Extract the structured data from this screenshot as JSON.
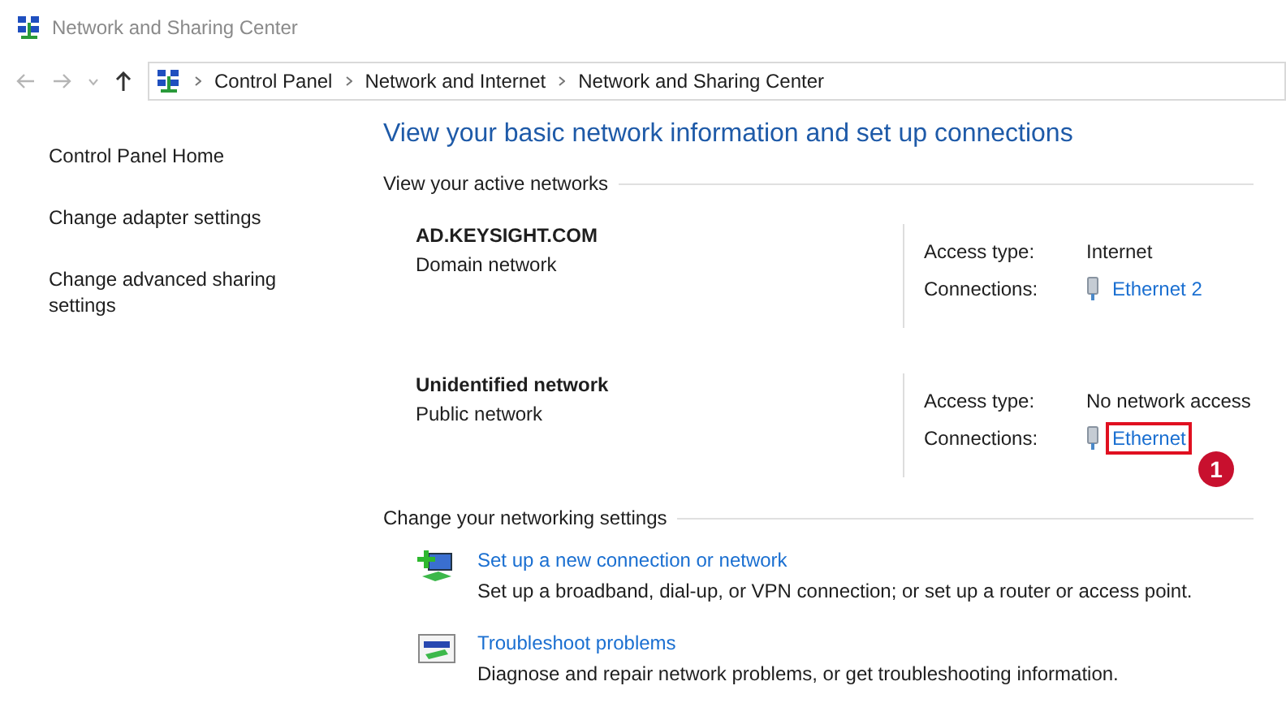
{
  "window": {
    "title": "Network and Sharing Center"
  },
  "address_bar": {
    "crumbs": [
      "Control Panel",
      "Network and Internet",
      "Network and Sharing Center"
    ]
  },
  "sidebar": {
    "items": [
      {
        "label": "Control Panel Home"
      },
      {
        "label": "Change adapter settings"
      },
      {
        "label": "Change advanced sharing settings"
      }
    ]
  },
  "heading": "View your basic network information and set up connections",
  "active_networks": {
    "title": "View your active networks",
    "networks": [
      {
        "name": "AD.KEYSIGHT.COM",
        "category": "Domain network",
        "access_label": "Access type:",
        "access": "Internet",
        "connections_label": "Connections:",
        "connection": "Ethernet 2",
        "highlighted": false
      },
      {
        "name": "Unidentified network",
        "category": "Public network",
        "access_label": "Access type:",
        "access": "No network access",
        "connections_label": "Connections:",
        "connection": "Ethernet",
        "highlighted": true,
        "callout": "1"
      }
    ]
  },
  "settings": {
    "title": "Change your networking settings",
    "items": [
      {
        "kind": "new-connection",
        "link": "Set up a new connection or network",
        "description": "Set up a broadband, dial-up, or VPN connection; or set up a router or access point."
      },
      {
        "kind": "troubleshoot",
        "link": "Troubleshoot problems",
        "description": "Diagnose and repair network problems, or get troubleshooting information."
      }
    ]
  }
}
